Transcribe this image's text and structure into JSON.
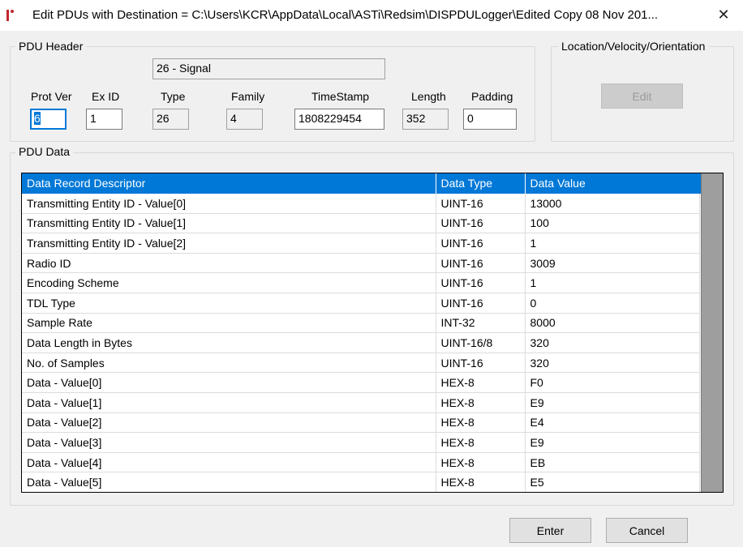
{
  "window": {
    "title": "Edit PDUs with Destination = C:\\Users\\KCR\\AppData\\Local\\ASTi\\Redsim\\DISPDULogger\\Edited Copy 08 Nov 201...",
    "close_glyph": "✕"
  },
  "pdu_header": {
    "group_label": "PDU Header",
    "pdu_type_display": "26 - Signal",
    "fields": {
      "prot_ver": {
        "label": "Prot Ver",
        "value": "6"
      },
      "ex_id": {
        "label": "Ex ID",
        "value": "1"
      },
      "type": {
        "label": "Type",
        "value": "26"
      },
      "family": {
        "label": "Family",
        "value": "4"
      },
      "timestamp": {
        "label": "TimeStamp",
        "value": "1808229454"
      },
      "length": {
        "label": "Length",
        "value": "352"
      },
      "padding": {
        "label": "Padding",
        "value": "0"
      }
    }
  },
  "location_group": {
    "group_label": "Location/Velocity/Orientation",
    "edit_label": "Edit"
  },
  "pdu_data": {
    "group_label": "PDU Data",
    "columns": [
      "Data Record Descriptor",
      "Data Type",
      "Data Value"
    ],
    "rows": [
      [
        "Transmitting Entity ID - Value[0]",
        "UINT-16",
        "13000"
      ],
      [
        "Transmitting Entity ID - Value[1]",
        "UINT-16",
        "100"
      ],
      [
        "Transmitting Entity ID - Value[2]",
        "UINT-16",
        "1"
      ],
      [
        "Radio ID",
        "UINT-16",
        "3009"
      ],
      [
        "Encoding Scheme",
        "UINT-16",
        "1"
      ],
      [
        "TDL Type",
        "UINT-16",
        "0"
      ],
      [
        "Sample Rate",
        "INT-32",
        "8000"
      ],
      [
        "Data Length in Bytes",
        "UINT-16/8",
        "320"
      ],
      [
        "No. of Samples",
        "UINT-16",
        "320"
      ],
      [
        "Data - Value[0]",
        "HEX-8",
        "F0"
      ],
      [
        "Data - Value[1]",
        "HEX-8",
        "E9"
      ],
      [
        "Data - Value[2]",
        "HEX-8",
        "E4"
      ],
      [
        "Data - Value[3]",
        "HEX-8",
        "E9"
      ],
      [
        "Data - Value[4]",
        "HEX-8",
        "EB"
      ],
      [
        "Data - Value[5]",
        "HEX-8",
        "E5"
      ]
    ]
  },
  "buttons": {
    "enter": "Enter",
    "cancel": "Cancel"
  }
}
